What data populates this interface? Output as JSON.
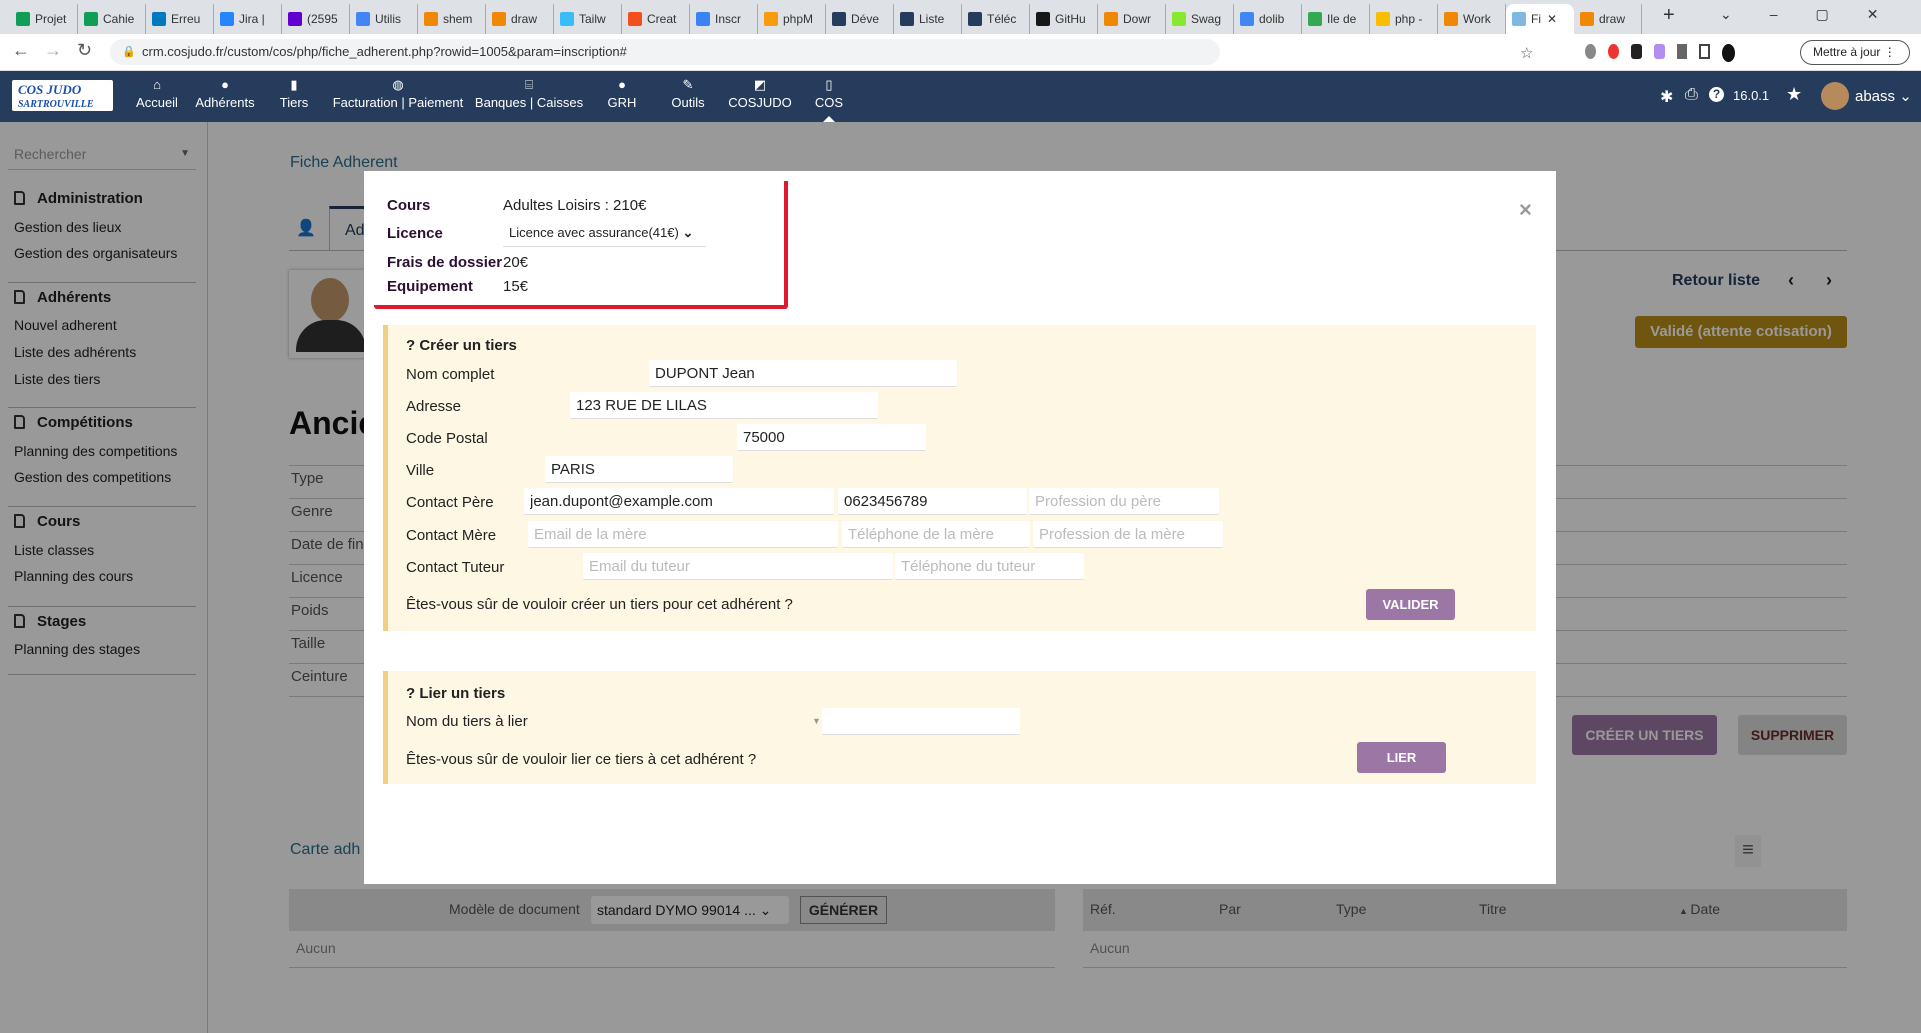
{
  "browser": {
    "tabs": [
      {
        "title": "Projet",
        "color": "#0f9d58"
      },
      {
        "title": "Cahie",
        "color": "#0f9d58"
      },
      {
        "title": "Erreu",
        "color": "#0079bf"
      },
      {
        "title": "Jira |",
        "color": "#2684ff"
      },
      {
        "title": "(2595",
        "color": "#6001d2"
      },
      {
        "title": "Utilis",
        "color": "#4285f4"
      },
      {
        "title": "shem",
        "color": "#f08705"
      },
      {
        "title": "draw",
        "color": "#f08705"
      },
      {
        "title": "Tailw",
        "color": "#38bdf8"
      },
      {
        "title": "Creat",
        "color": "#f24e1e"
      },
      {
        "title": "Inscr",
        "color": "#3b82f6"
      },
      {
        "title": "phpM",
        "color": "#f89c0e"
      },
      {
        "title": "Déve",
        "color": "#263c5c"
      },
      {
        "title": "Liste",
        "color": "#263c5c"
      },
      {
        "title": "Téléc",
        "color": "#263c5c"
      },
      {
        "title": "GitHu",
        "color": "#181717"
      },
      {
        "title": "Dowr",
        "color": "#f08705"
      },
      {
        "title": "Swag",
        "color": "#85ea2d"
      },
      {
        "title": "dolib",
        "color": "#4285f4"
      },
      {
        "title": "Ile de",
        "color": "#34a853"
      },
      {
        "title": "php -",
        "color": "#fbbc04"
      },
      {
        "title": "Work",
        "color": "#f08705"
      },
      {
        "title": "Fi",
        "color": "#7fb8e0",
        "active": true
      },
      {
        "title": "draw",
        "color": "#f08705"
      }
    ],
    "url": "crm.cosjudo.fr/custom/cos/php/fiche_adherent.php?rowid=1005&param=inscription#",
    "update_button": "Mettre à jour"
  },
  "nav": {
    "logo_text": "COS JUDO SARTROUVILLE",
    "items": [
      {
        "label": "Accueil",
        "icon": "home-icon"
      },
      {
        "label": "Adhérents",
        "icon": "user-icon"
      },
      {
        "label": "Tiers",
        "icon": "building-icon"
      },
      {
        "label": "Facturation | Paiement",
        "icon": "coins-icon"
      },
      {
        "label": "Banques | Caisses",
        "icon": "bank-icon"
      },
      {
        "label": "GRH",
        "icon": "user-tie-icon"
      },
      {
        "label": "Outils",
        "icon": "wrench-icon"
      },
      {
        "label": "COSJUDO",
        "icon": "external-icon"
      },
      {
        "label": "COS",
        "icon": "file-icon"
      }
    ],
    "version": "16.0.1",
    "user": "abass"
  },
  "sidebar": {
    "search_placeholder": "Rechercher",
    "sections": [
      {
        "title": "Administration",
        "items": [
          "Gestion des lieux",
          "Gestion des organisateurs"
        ]
      },
      {
        "title": "Adhérents",
        "items": [
          "Nouvel adherent",
          "Liste des adhérents",
          "Liste des tiers"
        ]
      },
      {
        "title": "Compétitions",
        "items": [
          "Planning des competitions",
          "Gestion des competitions"
        ]
      },
      {
        "title": "Cours",
        "items": [
          "Liste classes",
          "Planning des cours"
        ]
      },
      {
        "title": "Stages",
        "items": [
          "Planning des stages"
        ]
      }
    ]
  },
  "page": {
    "title": "Fiche Adherent",
    "tab_label": "Adh",
    "heading": "Ancie",
    "fields": [
      "Type",
      "Genre",
      "Date de fin",
      "Licence",
      "Poids",
      "Taille",
      "Ceinture"
    ],
    "back_link": "Retour liste",
    "status_badge": "Validé (attente cotisation)",
    "create_tiers_button": "CRÉER UN TIERS",
    "delete_button": "SUPPRIMER",
    "card_title": "Carte adh",
    "doc_model_label": "Modèle de document",
    "doc_model_value": "standard DYMO 99014 ...",
    "generate_button": "GÉNÉRER",
    "left_empty": "Aucun",
    "right_columns": [
      "Réf.",
      "Par",
      "Type",
      "Titre",
      "Date"
    ],
    "right_empty": "Aucun"
  },
  "modal": {
    "summary": {
      "cours_label": "Cours",
      "cours_value": "Adultes Loisirs : 210€",
      "licence_label": "Licence",
      "licence_value": "Licence avec assurance(41€)",
      "frais_label": "Frais de dossier",
      "frais_value": "20€",
      "equip_label": "Equipement",
      "equip_value": "15€"
    },
    "create": {
      "title": "Créer un tiers",
      "nom_label": "Nom complet",
      "nom_value": "DUPONT Jean",
      "adresse_label": "Adresse",
      "adresse_value": "123 RUE DE LILAS",
      "cp_label": "Code Postal",
      "cp_value": "75000",
      "ville_label": "Ville",
      "ville_value": "PARIS",
      "pere_label": "Contact Père",
      "pere_email": "jean.dupont@example.com",
      "pere_tel": "0623456789",
      "pere_prof_ph": "Profession du père",
      "mere_label": "Contact Mère",
      "mere_email_ph": "Email de la mère",
      "mere_tel_ph": "Téléphone de la mère",
      "mere_prof_ph": "Profession de la mère",
      "tuteur_label": "Contact Tuteur",
      "tuteur_email_ph": "Email du tuteur",
      "tuteur_tel_ph": "Téléphone du tuteur",
      "confirm": "Êtes-vous sûr de vouloir créer un tiers pour cet adhérent ?",
      "button": "VALIDER"
    },
    "link": {
      "title": "Lier un tiers",
      "nom_label": "Nom du tiers à lier",
      "confirm": "Êtes-vous sûr de vouloir lier ce tiers à cet adhérent ?",
      "button": "LIER"
    },
    "colors": {
      "highlight": "#e0182d",
      "section_bg": "#fdf7e4",
      "button": "#9c77a6"
    }
  }
}
